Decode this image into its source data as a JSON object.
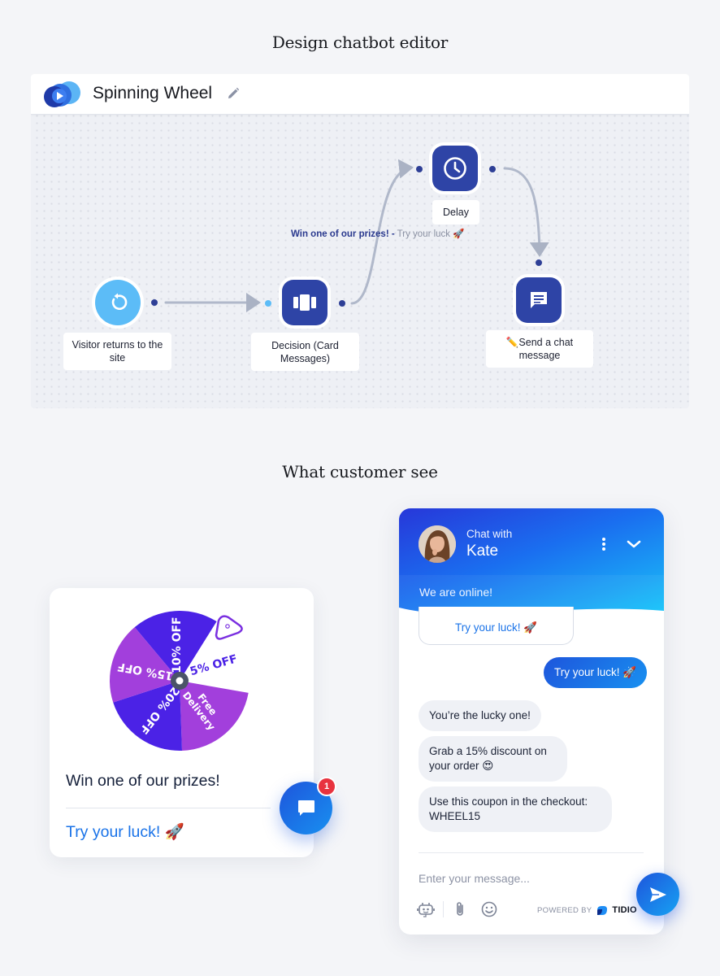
{
  "sections": {
    "editor_title": "Design chatbot editor",
    "customer_title": "What customer see"
  },
  "editor": {
    "title": "Spinning Wheel",
    "icons": {
      "logo": "tidio-logo",
      "edit": "pencil-icon"
    },
    "nodes": [
      {
        "id": "trigger",
        "label": "Visitor returns to the site",
        "icon": "refresh-icon",
        "type": "trigger"
      },
      {
        "id": "decision",
        "label": "Decision (Card Messages)",
        "icon": "cards-icon",
        "type": "action"
      },
      {
        "id": "delay",
        "label": "Delay",
        "icon": "clock-icon",
        "type": "action"
      },
      {
        "id": "send",
        "label": "✏️Send a chat message",
        "icon": "chat-icon",
        "type": "action"
      }
    ],
    "edge_label": {
      "strong": "Win one of our prizes! -",
      "muted": "Try your luck 🚀"
    },
    "colors": {
      "node": "#2e44a6",
      "trigger": "#5cbcf7",
      "edge": "#b8bfcf"
    }
  },
  "wheel_card": {
    "segments": [
      {
        "label": "10% OFF",
        "color": "#4b22e6"
      },
      {
        "label": "5% OFF",
        "color": "#ffffff"
      },
      {
        "label": "Free Delivery",
        "color": "#a23fdc"
      },
      {
        "label": "20% OFF",
        "color": "#4b22e6"
      },
      {
        "label": "15% OFF",
        "color": "#a23fdc"
      }
    ],
    "heading": "Win one of our prizes!",
    "cta": "Try your luck! 🚀",
    "launcher_badge": "1"
  },
  "chat": {
    "header": {
      "subtitle": "Chat with",
      "agent_name": "Kate",
      "status": "We are online!"
    },
    "card_button": "Try your luck! 🚀",
    "messages": [
      {
        "from": "visitor",
        "text": "Try your luck! 🚀"
      },
      {
        "from": "operator",
        "text": "You’re the lucky one!"
      },
      {
        "from": "operator",
        "text": "Grab a 15% discount on your order 😍"
      },
      {
        "from": "operator",
        "text": "Use this coupon in the checkout: WHEEL15"
      }
    ],
    "input": {
      "placeholder": "Enter your message...",
      "value": ""
    },
    "powered_by": "POWERED BY",
    "brand": "TIDIO",
    "colors": {
      "accent": "#1a73e8",
      "header_start": "#2737d9",
      "header_end": "#12c9fb"
    }
  }
}
